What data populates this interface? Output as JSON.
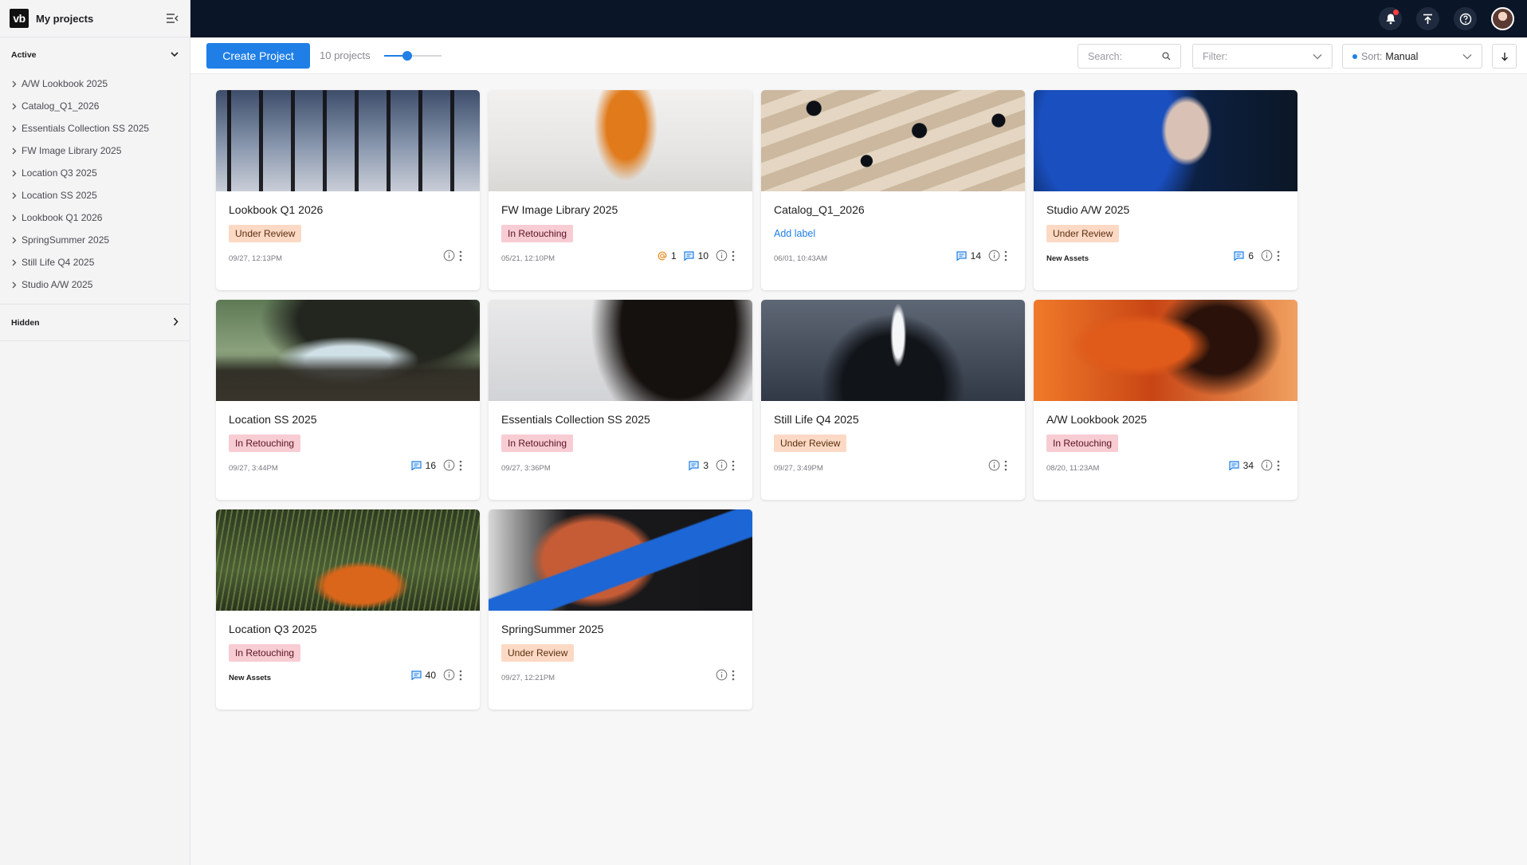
{
  "sidebar": {
    "logo": "vb",
    "title": "My projects",
    "active_label": "Active",
    "hidden_label": "Hidden",
    "items": [
      {
        "label": "A/W Lookbook 2025"
      },
      {
        "label": "Catalog_Q1_2026"
      },
      {
        "label": "Essentials Collection SS 2025"
      },
      {
        "label": "FW Image Library 2025"
      },
      {
        "label": "Location Q3 2025"
      },
      {
        "label": "Location SS 2025"
      },
      {
        "label": "Lookbook Q1 2026"
      },
      {
        "label": "SpringSummer 2025"
      },
      {
        "label": "Still Life Q4 2025"
      },
      {
        "label": "Studio A/W 2025"
      }
    ]
  },
  "topbar": {
    "icons": [
      "bell-icon",
      "upload-icon",
      "help-icon",
      "avatar"
    ],
    "notification_color": "#ff3b3b"
  },
  "toolbar": {
    "create_label": "Create Project",
    "project_count": "10 projects",
    "zoom_level": 0.4,
    "search_placeholder": "Search:",
    "filter_placeholder": "Filter:",
    "sort_prefix": "Sort:",
    "sort_value": "Manual"
  },
  "colors": {
    "accent": "#1f7fe6",
    "topbar_bg": "#0b1528",
    "under_review_bg": "#fcd9c4",
    "in_retouching_bg": "#f8ccd3"
  },
  "projects": [
    {
      "title": "Lookbook Q1 2026",
      "status": "Under Review",
      "date": "09/27, 12:13PM",
      "mentions": "",
      "comments": ""
    },
    {
      "title": "FW Image Library 2025",
      "status": "In Retouching",
      "date": "05/21, 12:10PM",
      "mentions": "1",
      "comments": "10"
    },
    {
      "title": "Catalog_Q1_2026",
      "status": "",
      "add_label": "Add label",
      "date": "06/01, 10:43AM",
      "mentions": "",
      "comments": "14"
    },
    {
      "title": "Studio A/W 2025",
      "status": "Under Review",
      "date": "New Assets",
      "mentions": "",
      "comments": "6"
    },
    {
      "title": "Location SS 2025",
      "status": "In Retouching",
      "date": "09/27, 3:44PM",
      "mentions": "",
      "comments": "16"
    },
    {
      "title": "Essentials Collection SS 2025",
      "status": "In Retouching",
      "date": "09/27, 3:36PM",
      "mentions": "",
      "comments": "3"
    },
    {
      "title": "Still Life Q4 2025",
      "status": "Under Review",
      "date": "09/27, 3:49PM",
      "mentions": "",
      "comments": ""
    },
    {
      "title": "A/W Lookbook 2025",
      "status": "In Retouching",
      "date": "08/20, 11:23AM",
      "mentions": "",
      "comments": "34"
    },
    {
      "title": "Location Q3 2025",
      "status": "In Retouching",
      "date": "New Assets",
      "mentions": "",
      "comments": "40"
    },
    {
      "title": "SpringSummer 2025",
      "status": "Under Review",
      "date": "09/27, 12:21PM",
      "mentions": "",
      "comments": ""
    }
  ]
}
